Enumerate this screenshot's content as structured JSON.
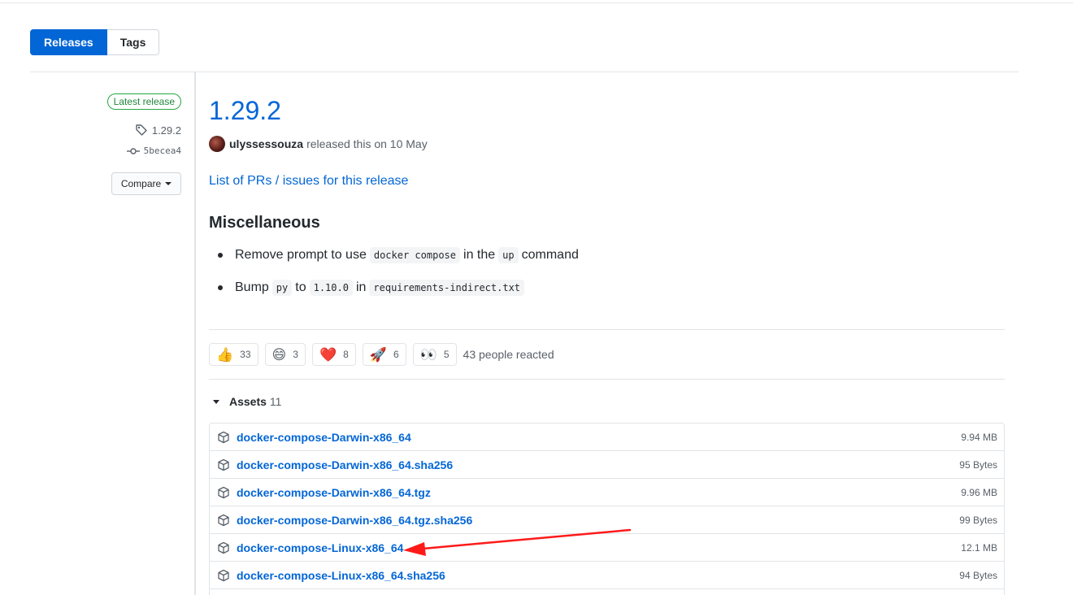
{
  "tabs": {
    "releases": "Releases",
    "tags": "Tags"
  },
  "sidebar": {
    "latest_badge": "Latest release",
    "tag": "1.29.2",
    "commit": "5becea4",
    "compare_label": "Compare"
  },
  "release": {
    "title": "1.29.2",
    "author": "ulyssessouza",
    "released_text": "released this on 10 May",
    "prs_link": "List of PRs / issues for this release",
    "section_heading": "Miscellaneous",
    "bullets": [
      {
        "t1": "Remove prompt to use",
        "c1": "docker compose",
        "t2": "in the",
        "c2": "up",
        "t3": "command"
      },
      {
        "t1": "Bump",
        "c1": "py",
        "t2": "to",
        "c2": "1.10.0",
        "t3": "in",
        "c3": "requirements-indirect.txt"
      }
    ]
  },
  "reactions": {
    "items": [
      {
        "emoji": "👍",
        "count": "33",
        "icon": "thumbs-up-icon"
      },
      {
        "emoji": "😄",
        "count": "3",
        "icon": "laugh-icon"
      },
      {
        "emoji": "❤️",
        "count": "8",
        "icon": "heart-icon"
      },
      {
        "emoji": "🚀",
        "count": "6",
        "icon": "rocket-icon"
      },
      {
        "emoji": "👀",
        "count": "5",
        "icon": "eyes-icon"
      }
    ],
    "summary": "43 people reacted"
  },
  "assets": {
    "label": "Assets",
    "count": "11",
    "items": [
      {
        "name": "docker-compose-Darwin-x86_64",
        "size": "9.94 MB"
      },
      {
        "name": "docker-compose-Darwin-x86_64.sha256",
        "size": "95 Bytes"
      },
      {
        "name": "docker-compose-Darwin-x86_64.tgz",
        "size": "9.96 MB"
      },
      {
        "name": "docker-compose-Darwin-x86_64.tgz.sha256",
        "size": "99 Bytes"
      },
      {
        "name": "docker-compose-Linux-x86_64",
        "size": "12.1 MB"
      },
      {
        "name": "docker-compose-Linux-x86_64.sha256",
        "size": "94 Bytes"
      },
      {
        "name": "",
        "size": ""
      }
    ]
  },
  "colors": {
    "accent": "#0366d6",
    "success": "#28a745",
    "annotation": "#ff1a1a"
  }
}
